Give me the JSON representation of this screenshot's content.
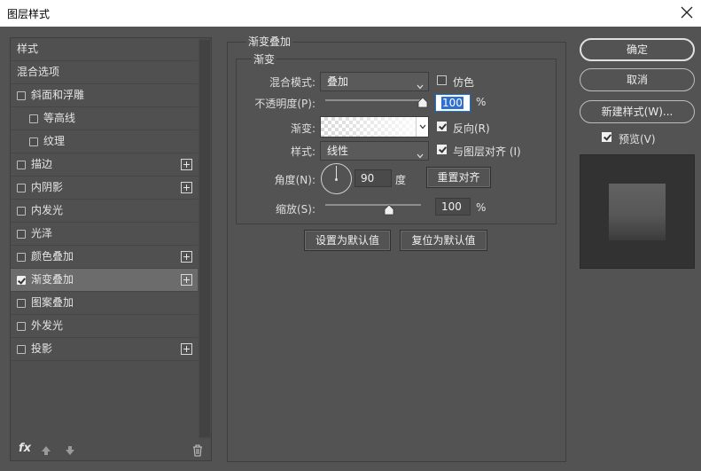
{
  "window": {
    "title": "图层样式"
  },
  "style_list": {
    "items": [
      {
        "label": "样式",
        "checkbox": false,
        "checked": false,
        "plus": false,
        "indent": 0,
        "active": false
      },
      {
        "label": "混合选项",
        "checkbox": false,
        "checked": false,
        "plus": false,
        "indent": 0,
        "active": false
      },
      {
        "label": "斜面和浮雕",
        "checkbox": true,
        "checked": false,
        "plus": false,
        "indent": 0,
        "active": false
      },
      {
        "label": "等高线",
        "checkbox": true,
        "checked": false,
        "plus": false,
        "indent": 1,
        "active": false
      },
      {
        "label": "纹理",
        "checkbox": true,
        "checked": false,
        "plus": false,
        "indent": 1,
        "active": false
      },
      {
        "label": "描边",
        "checkbox": true,
        "checked": false,
        "plus": true,
        "indent": 0,
        "active": false
      },
      {
        "label": "内阴影",
        "checkbox": true,
        "checked": false,
        "plus": true,
        "indent": 0,
        "active": false
      },
      {
        "label": "内发光",
        "checkbox": true,
        "checked": false,
        "plus": false,
        "indent": 0,
        "active": false
      },
      {
        "label": "光泽",
        "checkbox": true,
        "checked": false,
        "plus": false,
        "indent": 0,
        "active": false
      },
      {
        "label": "颜色叠加",
        "checkbox": true,
        "checked": false,
        "plus": true,
        "indent": 0,
        "active": false
      },
      {
        "label": "渐变叠加",
        "checkbox": true,
        "checked": true,
        "plus": true,
        "indent": 0,
        "active": true
      },
      {
        "label": "图案叠加",
        "checkbox": true,
        "checked": false,
        "plus": false,
        "indent": 0,
        "active": false
      },
      {
        "label": "外发光",
        "checkbox": true,
        "checked": false,
        "plus": false,
        "indent": 0,
        "active": false
      },
      {
        "label": "投影",
        "checkbox": true,
        "checked": false,
        "plus": true,
        "indent": 0,
        "active": false
      }
    ],
    "fx_label": "fx"
  },
  "gradient_overlay": {
    "section_title": "渐变叠加",
    "group_title": "渐变",
    "blend_mode": {
      "label": "混合模式:",
      "value": "叠加"
    },
    "dither": {
      "label": "仿色",
      "checked": false
    },
    "opacity": {
      "label": "不透明度(P):",
      "value": "100",
      "unit": "%",
      "percent": 100
    },
    "gradient": {
      "label": "渐变:"
    },
    "reverse": {
      "label": "反向(R)",
      "checked": true
    },
    "style": {
      "label": "样式:",
      "value": "线性"
    },
    "align_with_layer": {
      "label": "与图层对齐 (I)",
      "checked": true
    },
    "angle": {
      "label": "角度(N):",
      "value": "90",
      "unit": "度"
    },
    "reset_alignment_label": "重置对齐",
    "scale": {
      "label": "缩放(S):",
      "value": "100",
      "unit": "%",
      "percent": 100
    },
    "set_default_label": "设置为默认值",
    "reset_default_label": "复位为默认值"
  },
  "actions": {
    "ok_label": "确定",
    "cancel_label": "取消",
    "new_style_label": "新建样式(W)...",
    "preview": {
      "label": "预览(V)",
      "checked": true
    }
  }
}
